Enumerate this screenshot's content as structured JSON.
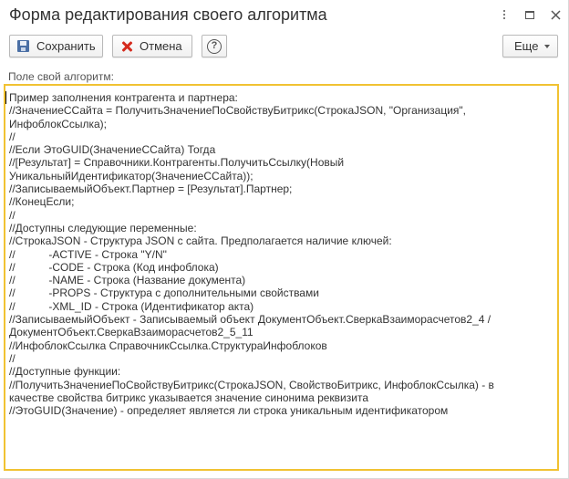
{
  "window": {
    "title": "Форма редактирования своего алгоритма",
    "controls": [
      "more-icon",
      "maximize-icon",
      "close-icon"
    ]
  },
  "toolbar": {
    "save_label": "Сохранить",
    "cancel_label": "Отмена",
    "help_glyph": "?",
    "more_label": "Еще"
  },
  "field": {
    "label": "Поле свой алгоритм:"
  },
  "colors": {
    "accent_border": "#f1c232",
    "cancel_icon": "#d52b1e",
    "save_icon": "#4a6fa5"
  },
  "editor": {
    "lines": [
      "Пример заполнения контрагента и партнера:",
      "//ЗначениеССайта = ПолучитьЗначениеПоСвойствуБитрикс(СтрокаJSON, \"Организация\",",
      "ИнфоблокСсылка);",
      "//",
      "//Если ЭтоGUID(ЗначениеССайта) Тогда",
      "//[Результат] = Справочники.Контрагенты.ПолучитьСсылку(Новый",
      "УникальныйИдентификатор(ЗначениеССайта));",
      "//ЗаписываемыйОбъект.Партнер = [Результат].Партнер;",
      "//КонецЕсли;",
      "//",
      "//Доступны следующие переменные:",
      "//СтрокаJSON - Структура JSON с сайта. Предполагается наличие ключей:",
      "//           -ACTIVE - Строка \"Y/N\"",
      "//           -CODE - Строка (Код инфоблока)",
      "//           -NAME - Строка (Название документа)",
      "//           -PROPS - Структура с дополнительными свойствами",
      "//           -XML_ID - Строка (Идентификатор акта)",
      "//ЗаписываемыйОбъект - Записываемый объект ДокументОбъект.СверкаВзаиморасчетов2_4 /",
      "ДокументОбъект.СверкаВзаиморасчетов2_5_11",
      "//ИнфоблокСсылка СправочникСсылка.СтруктураИнфоблоков",
      "//",
      "//Доступные функции:",
      "//ПолучитьЗначениеПоСвойствуБитрикс(СтрокаJSON, СвойствоБитрикс, ИнфоблокСсылка) - в",
      "качестве свойства битрикс указывается значение синонима реквизита",
      "//ЭтоGUID(Значение) - определяет является ли строка уникальным идентификатором"
    ]
  }
}
